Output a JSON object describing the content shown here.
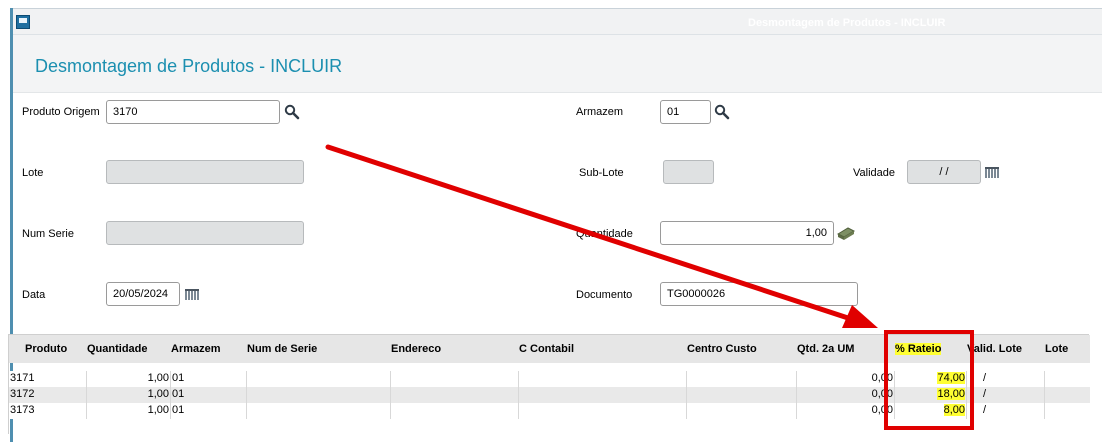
{
  "window": {
    "title": "Desmontagem de Produtos - INCLUIR"
  },
  "page": {
    "title": "Desmontagem de Produtos - INCLUIR"
  },
  "form": {
    "produto_origem": {
      "label": "Produto Origem",
      "value": "3170"
    },
    "armazem": {
      "label": "Armazem",
      "value": "01"
    },
    "lote": {
      "label": "Lote",
      "value": ""
    },
    "sub_lote": {
      "label": "Sub-Lote",
      "value": ""
    },
    "validade": {
      "label": "Validade",
      "value": "/ /"
    },
    "num_serie": {
      "label": "Num Serie",
      "value": ""
    },
    "quantidade": {
      "label": "Quantidade",
      "value": "1,00"
    },
    "data": {
      "label": "Data",
      "value": "20/05/2024"
    },
    "documento": {
      "label": "Documento",
      "value": "TG0000026"
    }
  },
  "grid": {
    "columns": [
      "Produto",
      "Quantidade",
      "Armazem",
      "Num de Serie",
      "Endereco",
      "C Contabil",
      "Centro Custo",
      "Qtd. 2a UM",
      "% Rateio",
      "Valid. Lote",
      "Lote"
    ],
    "rows": [
      {
        "produto": "3171",
        "quantidade": "1,00",
        "armazem": "01",
        "qtd2": "0,00",
        "rateio": "74,00",
        "valid": "/"
      },
      {
        "produto": "3172",
        "quantidade": "1,00",
        "armazem": "01",
        "qtd2": "0,00",
        "rateio": "18,00",
        "valid": "/"
      },
      {
        "produto": "3173",
        "quantidade": "1,00",
        "armazem": "01",
        "qtd2": "0,00",
        "rateio": "8,00",
        "valid": "/"
      }
    ]
  },
  "colors": {
    "accent": "#1b8fb0",
    "highlight": "#ffff33",
    "annotation": "#e00000"
  }
}
